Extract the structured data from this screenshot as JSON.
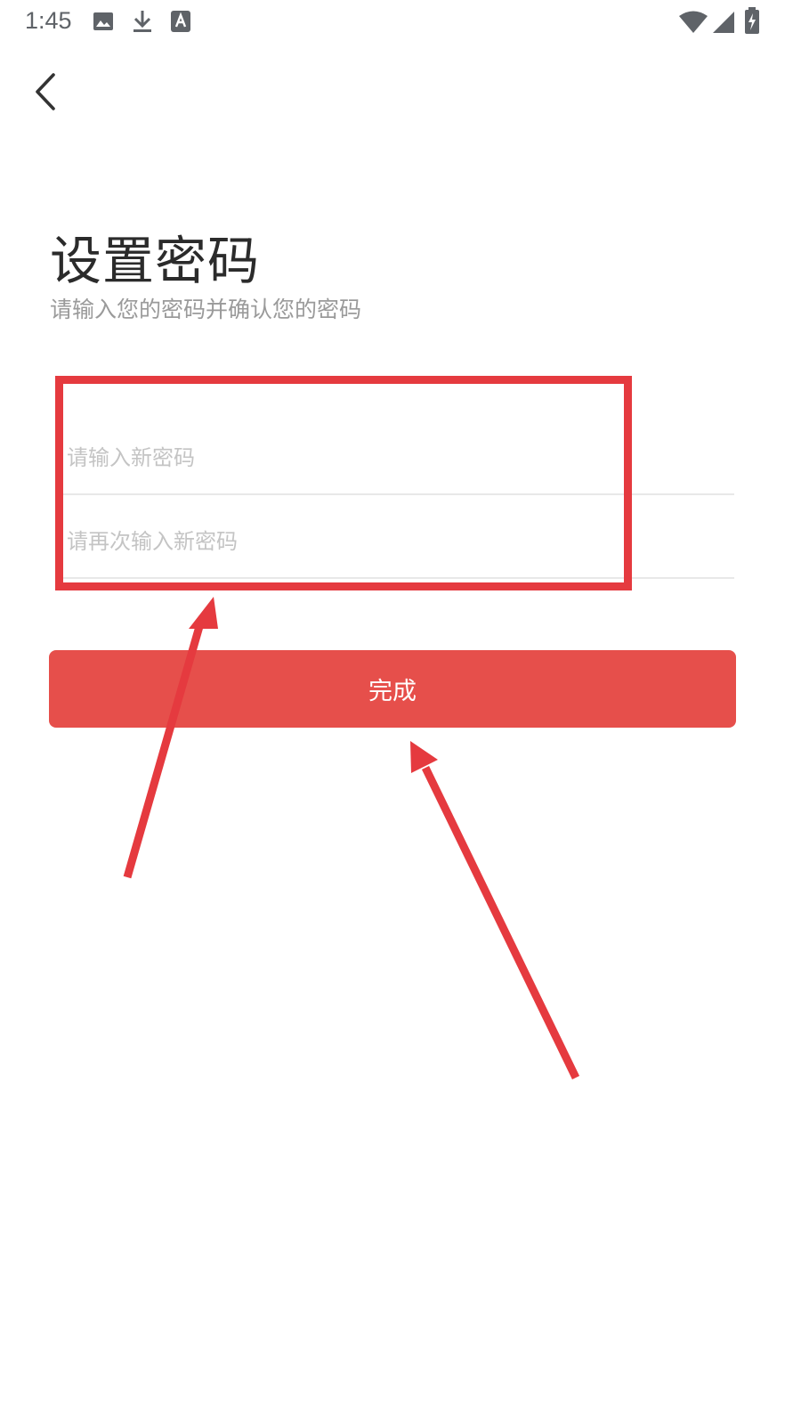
{
  "status_bar": {
    "time": "1:45",
    "icons": [
      "image-icon",
      "download-icon",
      "text-a-icon",
      "wifi-icon",
      "cellular-signal-icon",
      "battery-charging-icon"
    ]
  },
  "nav": {
    "back_icon": "chevron-left-icon"
  },
  "header": {
    "title": "设置密码",
    "subtitle": "请输入您的密码并确认您的密码"
  },
  "form": {
    "new_password": {
      "value": "",
      "placeholder": "请输入新密码"
    },
    "confirm_password": {
      "value": "",
      "placeholder": "请再次输入新密码"
    },
    "submit_label": "完成"
  },
  "colors": {
    "accent": "#e64f4b",
    "annotation": "#e53a3f",
    "placeholder": "#c4c4c4",
    "subtitle": "#9a9a9a",
    "divider": "#e8e8e8"
  }
}
